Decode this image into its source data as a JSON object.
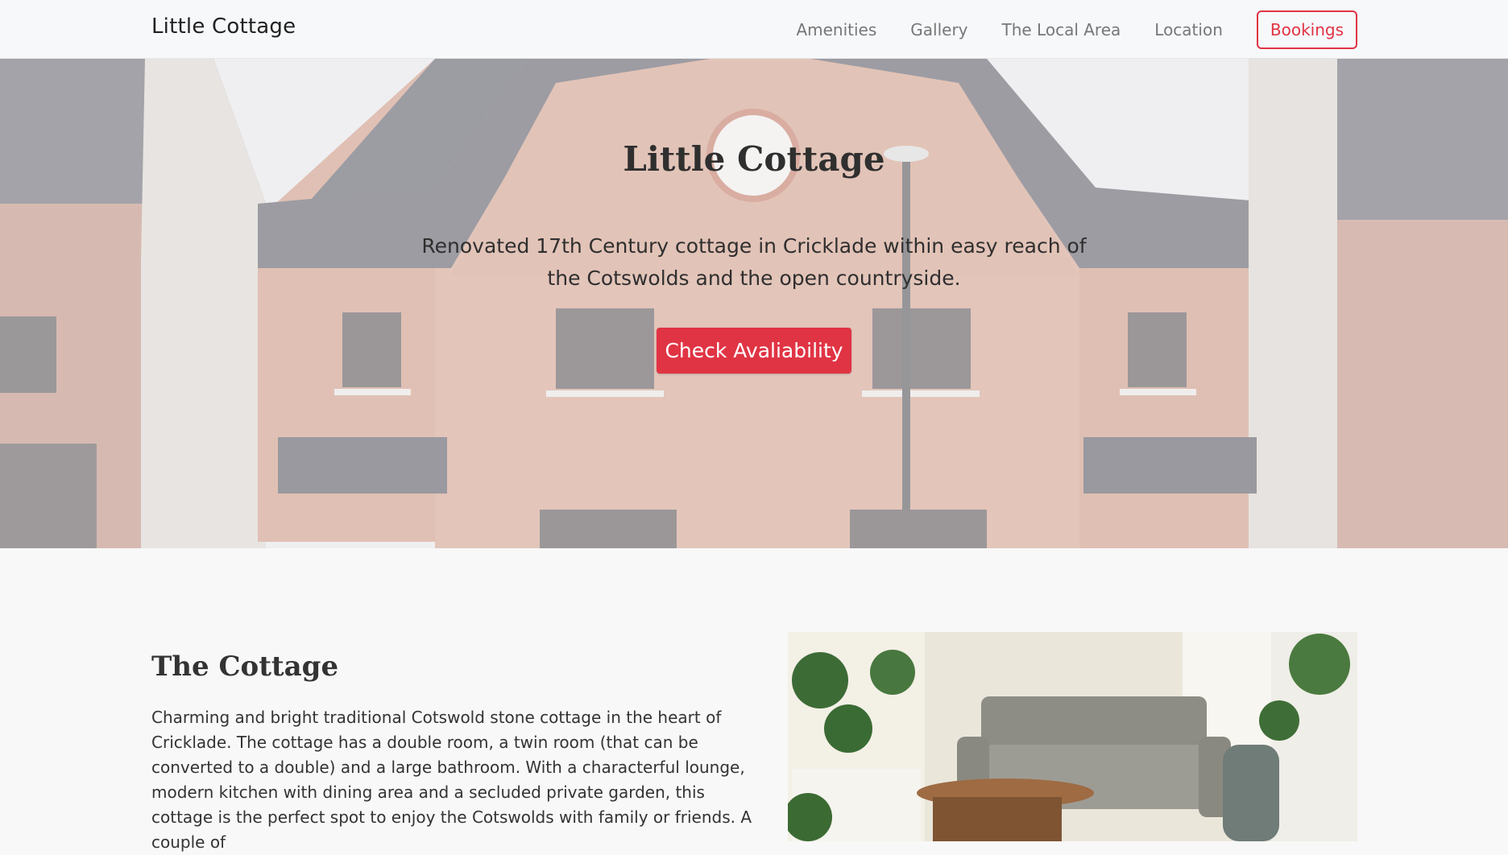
{
  "navbar": {
    "brand": "Little Cottage",
    "links": [
      {
        "label": "Amenities"
      },
      {
        "label": "Gallery"
      },
      {
        "label": "The Local Area"
      },
      {
        "label": "Location"
      }
    ],
    "bookings_label": "Bookings"
  },
  "hero": {
    "title": "Little Cottage",
    "subtitle": "Renovated 17th Century cottage in Cricklade within easy reach of the Cotswolds and the open countryside.",
    "cta_label": "Check Avaliability"
  },
  "about": {
    "title": "The Cottage",
    "text": "Charming and bright traditional Cotswold stone cottage in the heart of Cricklade. The cottage has a double room, a twin room (that can be converted to a double) and a large bathroom. With a characterful lounge, modern kitchen with dining area and a secluded private garden, this cottage is the perfect spot to enjoy the Cotswolds with family or friends. A couple of"
  },
  "colors": {
    "accent": "#e03444",
    "nav_background": "#f7f8fa",
    "page_background": "#f8f8f8"
  }
}
